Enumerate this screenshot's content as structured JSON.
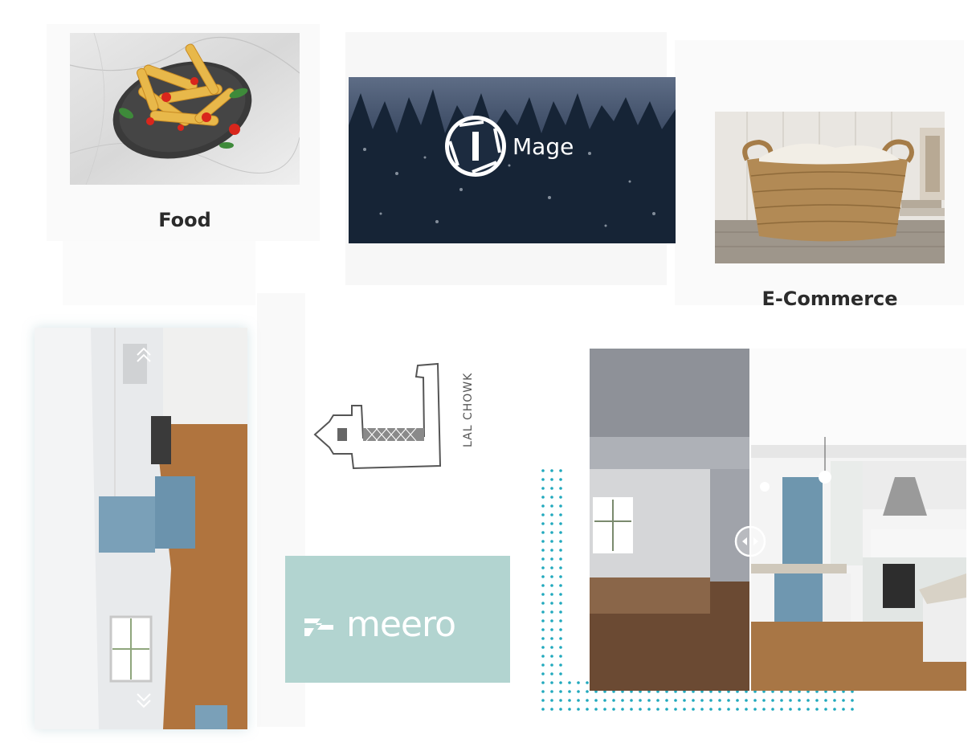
{
  "colors": {
    "teal_dots": "#21a9bd",
    "title_text": "#2b2b2b",
    "meero_bg": "#b2d4d0",
    "forest_bg": "#1c2b3f"
  },
  "cards": {
    "food": {
      "label": "Food"
    },
    "ecommerce": {
      "label": "E-Commerce"
    }
  },
  "logos": {
    "image": {
      "brand_text": "Mage"
    },
    "lalchowk": {
      "text": "LAL CHOWK"
    },
    "meero": {
      "text": "meero"
    }
  },
  "viewer": {
    "up_arrow": "up-chevrons-icon",
    "down_arrow": "down-chevrons-icon",
    "compare_handle": "compare-handle-icon"
  }
}
